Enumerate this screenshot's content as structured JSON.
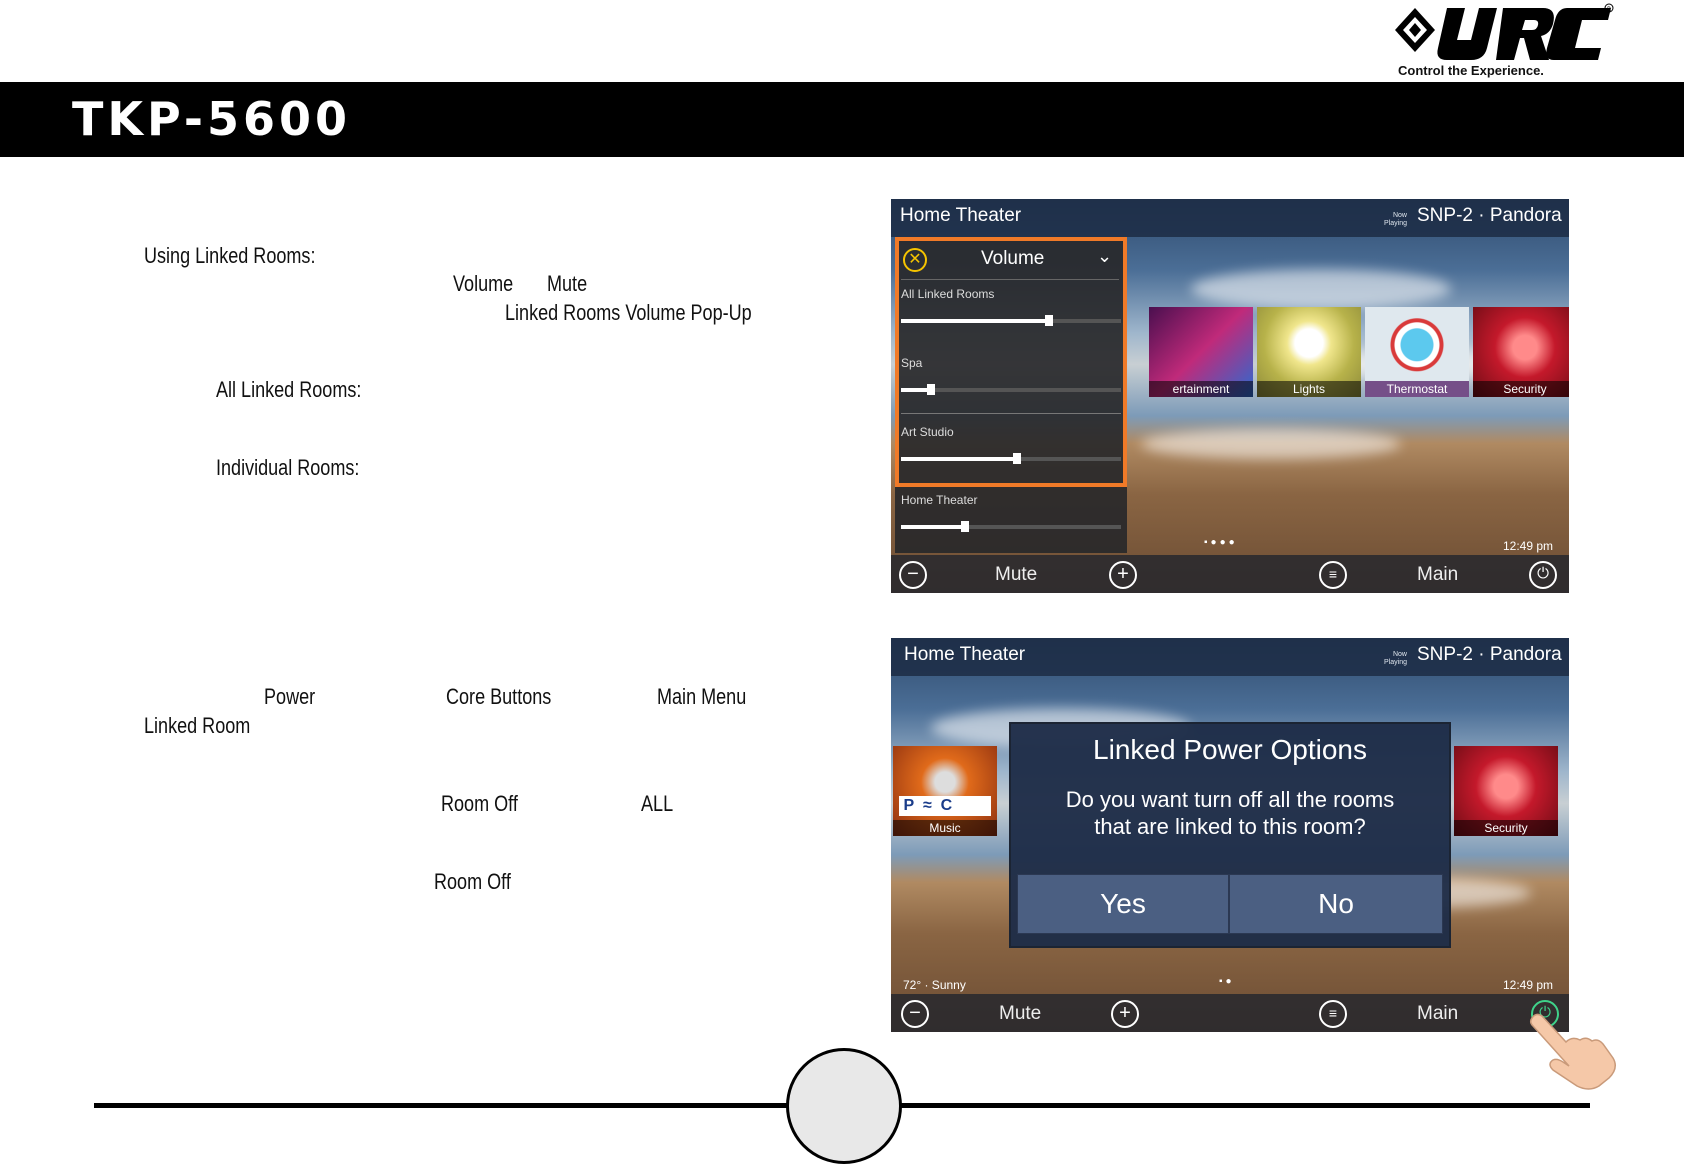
{
  "header": {
    "model": "TKP-5600",
    "brand_tagline": "Control the Experience."
  },
  "doc": {
    "using_linked_rooms": "Using Linked Rooms:",
    "volume": "Volume",
    "mute": "Mute",
    "popup": "Linked Rooms Volume Pop-Up",
    "all_linked_rooms": "All Linked Rooms:",
    "individual_rooms": "Individual Rooms:",
    "power": "Power",
    "core_buttons": "Core Buttons",
    "main_menu": "Main Menu",
    "linked_room": "Linked Room",
    "room_off_1": "Room Off",
    "all": "ALL",
    "room_off_2": "Room Off"
  },
  "screen1": {
    "room": "Home Theater",
    "now_playing": "Now Playing",
    "source": "SNP-2 · Pandora",
    "volume_title": "Volume",
    "rows": [
      {
        "label": "All Linked Rooms",
        "level": 0.75
      },
      {
        "label": "Spa",
        "level": 0.12
      },
      {
        "label": "Art Studio",
        "level": 0.5
      },
      {
        "label": "Home Theater",
        "level": 0.3
      }
    ],
    "tiles": [
      "ertainment",
      "Lights",
      "Thermostat",
      "Security"
    ],
    "time": "12:49 pm",
    "mute": "Mute",
    "main": "Main"
  },
  "screen2": {
    "room": "Home Theater",
    "now_playing": "Now Playing",
    "source": "SNP-2 · Pandora",
    "dialog_title": "Linked Power Options",
    "dialog_msg_line1": "Do you want turn off all the rooms",
    "dialog_msg_line2": "that are linked to this room?",
    "yes": "Yes",
    "no": "No",
    "tiles": [
      "Music",
      "Security"
    ],
    "weather": "72° · Sunny",
    "time": "12:49 pm",
    "mute": "Mute",
    "main": "Main"
  },
  "colors": {
    "highlight": "#f07a28",
    "header_bg": "#000000"
  }
}
